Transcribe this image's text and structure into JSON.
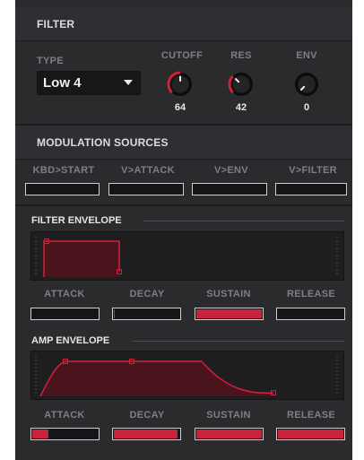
{
  "filter": {
    "title": "FILTER",
    "type_label": "TYPE",
    "type_value": "Low 4",
    "knobs": [
      {
        "label": "CUTOFF",
        "value": "64",
        "level": 0.5,
        "accent": "#d0213b"
      },
      {
        "label": "RES",
        "value": "42",
        "level": 0.33,
        "accent": "#d0213b"
      },
      {
        "label": "ENV",
        "value": "0",
        "level": 0,
        "accent": "#d0213b"
      }
    ]
  },
  "modulation": {
    "title": "MODULATION SOURCES",
    "sources": [
      {
        "label": "KBD>START",
        "amount": 0
      },
      {
        "label": "V>ATTACK",
        "amount": 0
      },
      {
        "label": "V>ENV",
        "amount": 0
      },
      {
        "label": "V>FILTER",
        "amount": 0
      }
    ]
  },
  "filter_envelope": {
    "title": "FILTER ENVELOPE",
    "params": [
      {
        "label": "ATTACK",
        "amount": 0
      },
      {
        "label": "DECAY",
        "amount": 0.02
      },
      {
        "label": "SUSTAIN",
        "amount": 1.0
      },
      {
        "label": "RELEASE",
        "amount": 0
      }
    ]
  },
  "amp_envelope": {
    "title": "AMP ENVELOPE",
    "params": [
      {
        "label": "ATTACK",
        "amount": 0.25
      },
      {
        "label": "DECAY",
        "amount": 0.97
      },
      {
        "label": "SUSTAIN",
        "amount": 1.0
      },
      {
        "label": "RELEASE",
        "amount": 1.0
      }
    ]
  },
  "colors": {
    "accent": "#c8233b",
    "panel": "#2b2b2e",
    "display": "#1e1e20",
    "env_fill": "#4a141c"
  }
}
